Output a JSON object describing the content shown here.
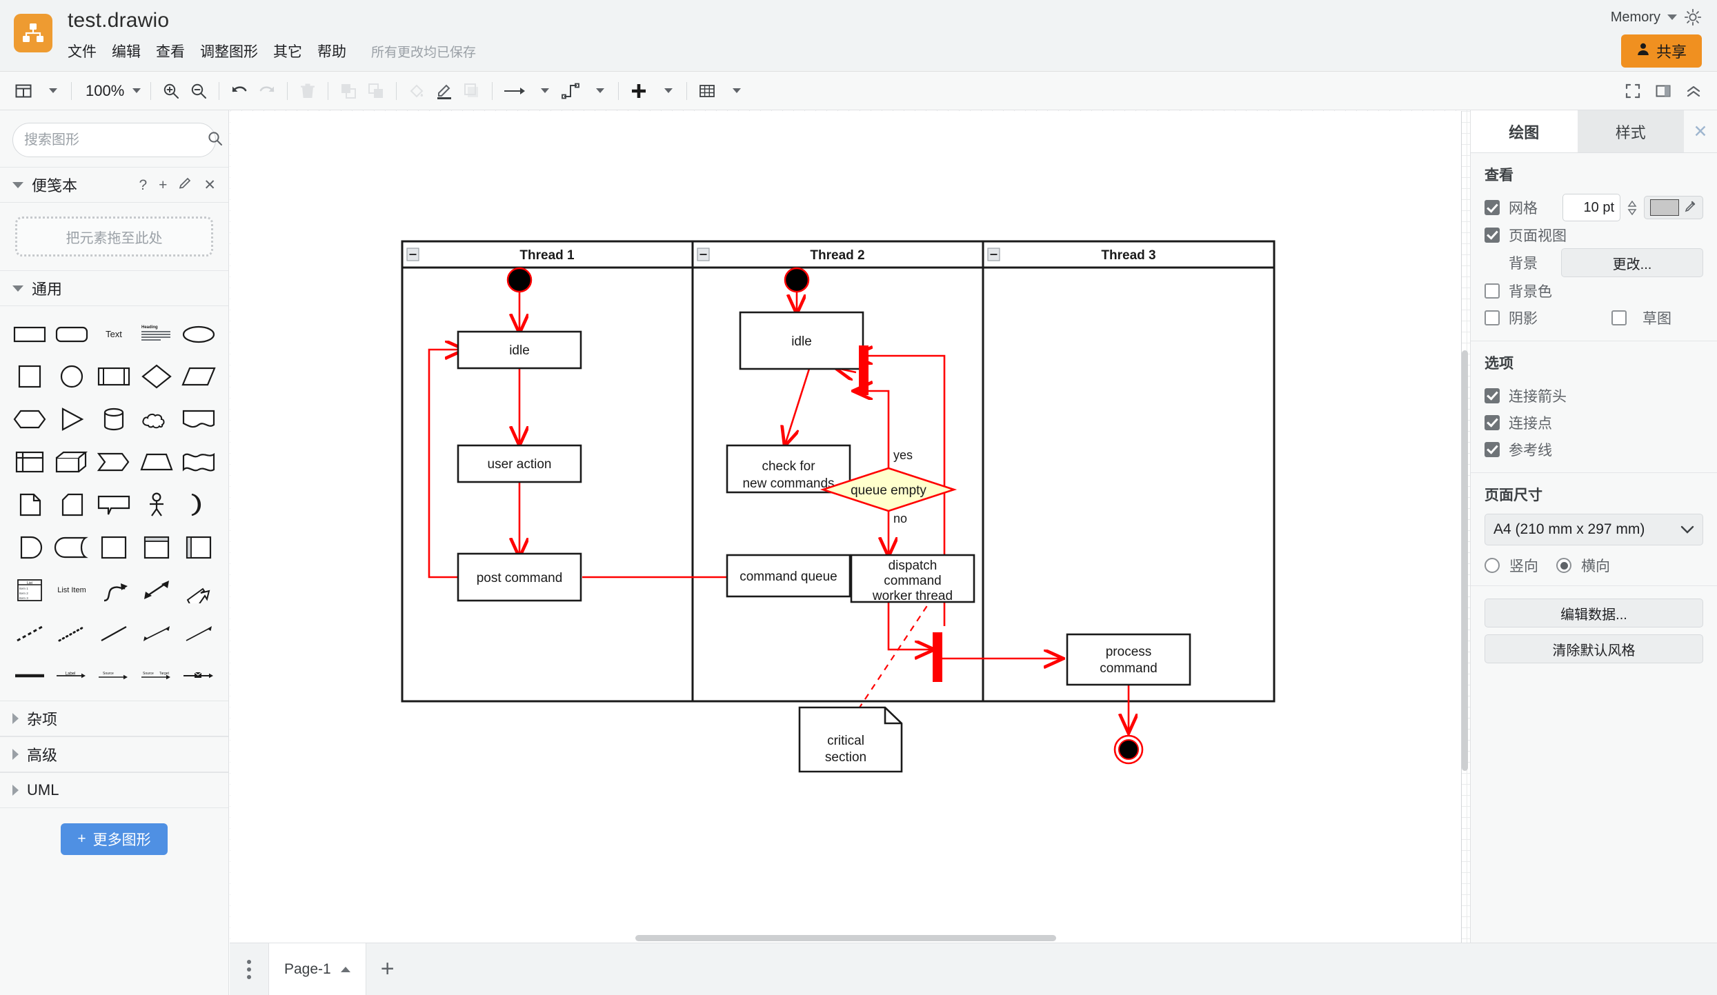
{
  "header": {
    "logo_icon": "drawio-logo-icon",
    "doc_title": "test.drawio",
    "menus": [
      "文件",
      "编辑",
      "查看",
      "调整图形",
      "其它",
      "帮助"
    ],
    "save_status": "所有更改均已保存",
    "memory_label": "Memory",
    "theme_icon": "sun-icon",
    "share_label": "共享",
    "share_icon": "user-icon",
    "share_color": "#f09020"
  },
  "toolbar": {
    "view_layout_icon": "panel-layout-icon",
    "zoom_level": "100%",
    "zoom_in_icon": "zoom-in-icon",
    "zoom_out_icon": "zoom-out-icon",
    "undo_icon": "undo-icon",
    "redo_icon": "redo-icon",
    "delete_icon": "trash-icon",
    "to_front_icon": "bring-to-front-icon",
    "to_back_icon": "send-to-back-icon",
    "fill_icon": "fill-color-icon",
    "line_icon": "line-color-icon",
    "shadow_icon": "shadow-icon",
    "waypoints_icon": "arrow-style-icon",
    "connection_icon": "connection-style-icon",
    "insert_icon": "plus-icon",
    "table_icon": "table-icon",
    "fullscreen_icon": "fullscreen-icon",
    "format_panel_icon": "format-panel-icon",
    "collapse_icon": "chevron-double-up-icon"
  },
  "sidebar": {
    "search_placeholder": "搜索图形",
    "search_value": "",
    "search_icon": "search-icon",
    "scratchpad": {
      "title": "便笺本",
      "help_icon": "question-icon",
      "add_icon": "plus-icon",
      "edit_icon": "pencil-icon",
      "close_icon": "close-icon",
      "dropzone_text": "把元素拖至此处"
    },
    "general_section": {
      "title": "通用",
      "shapes": [
        "rectangle",
        "rounded-rectangle",
        "text",
        "textbox",
        "ellipse",
        "square",
        "circle",
        "process",
        "rhombus",
        "parallelogram",
        "hexagon",
        "triangle",
        "cylinder",
        "cloud",
        "document",
        "internal-storage",
        "cube",
        "step",
        "trapezoid",
        "tape",
        "note",
        "card",
        "callout",
        "actor",
        "or-shape",
        "data-storage",
        "delay",
        "container",
        "vertical-container",
        "horizontal-container",
        "list",
        "list-item",
        "curve-arrow",
        "bidirectional-arrow",
        "block-arrow",
        "dashed-line",
        "dotted-line",
        "plain-line",
        "bidirectional-line",
        "directional-line",
        "thick-line",
        "labeled-arrow",
        "source-target-arrow",
        "source-target-label-arrow",
        "message-arrow"
      ]
    },
    "collapsed_sections": [
      "杂项",
      "高级",
      "UML"
    ],
    "more_shapes_label": "更多图形",
    "more_shapes_icon": "plus-icon",
    "more_shapes_color": "#4f90e3"
  },
  "right_panel": {
    "tabs": [
      {
        "label": "绘图",
        "active": true
      },
      {
        "label": "样式",
        "active": false
      }
    ],
    "close_icon": "close-icon",
    "view_section": {
      "title": "查看",
      "grid_label": "网格",
      "grid_checked": true,
      "grid_size": "10 pt",
      "grid_color": "#c8c8c8",
      "eyedropper_icon": "eyedropper-icon",
      "page_view_label": "页面视图",
      "page_view_checked": true,
      "background_label": "背景",
      "background_button": "更改...",
      "background_color_label": "背景色",
      "background_color_checked": false,
      "shadow_label": "阴影",
      "shadow_checked": false,
      "sketch_label": "草图",
      "sketch_checked": false
    },
    "options_section": {
      "title": "选项",
      "items": [
        {
          "label": "连接箭头",
          "checked": true
        },
        {
          "label": "连接点",
          "checked": true
        },
        {
          "label": "参考线",
          "checked": true
        }
      ]
    },
    "page_size_section": {
      "title": "页面尺寸",
      "selected": "A4 (210 mm x 297 mm)",
      "orientation": [
        {
          "label": "竖向",
          "checked": false
        },
        {
          "label": "横向",
          "checked": true
        }
      ]
    },
    "buttons": [
      "编辑数据...",
      "清除默认风格"
    ]
  },
  "bottom_bar": {
    "menu_icon": "vertical-dots-icon",
    "page_tab": "Page-1",
    "page_tab_chevron": "chevron-up-icon",
    "add_page_icon": "plus-icon"
  },
  "diagram": {
    "type": "uml-activity-swimlane",
    "accent_color": "#ff0000",
    "decision_fill": "#ffffcc",
    "lanes": [
      {
        "title": "Thread 1",
        "collapse_icon": "collapse-icon"
      },
      {
        "title": "Thread 2",
        "collapse_icon": "collapse-icon"
      },
      {
        "title": "Thread 3",
        "collapse_icon": "collapse-icon"
      }
    ],
    "nodes": [
      {
        "id": "start1",
        "type": "initial-node",
        "label": "",
        "lane": "Thread 1"
      },
      {
        "id": "idle1",
        "type": "activity",
        "label": "idle",
        "lane": "Thread 1"
      },
      {
        "id": "useract",
        "type": "activity",
        "label": "user action",
        "lane": "Thread 1"
      },
      {
        "id": "postcmd",
        "type": "activity",
        "label": "post command",
        "lane": "Thread 1"
      },
      {
        "id": "start2",
        "type": "initial-node",
        "label": "",
        "lane": "Thread 2"
      },
      {
        "id": "idle2",
        "type": "activity",
        "label": "idle",
        "lane": "Thread 2"
      },
      {
        "id": "bar1",
        "type": "sync-bar",
        "label": "",
        "lane": "Thread 2"
      },
      {
        "id": "checkcmd",
        "type": "activity",
        "label": "check for\nnew commands",
        "lane": "Thread 2"
      },
      {
        "id": "qempty",
        "type": "decision",
        "label": "queue empty",
        "lane": "Thread 2"
      },
      {
        "id": "cmdqueue",
        "type": "activity",
        "label": "command queue",
        "lane": "Thread 2"
      },
      {
        "id": "dispatch",
        "type": "activity",
        "label": "dispatch\ncommand\nworker thread",
        "lane": "Thread 2"
      },
      {
        "id": "bar2",
        "type": "sync-bar",
        "label": "",
        "lane": "Thread 2"
      },
      {
        "id": "note",
        "type": "note",
        "label": "critical\nsection",
        "lane": "Thread 2"
      },
      {
        "id": "proccmd",
        "type": "activity",
        "label": "process\ncommand",
        "lane": "Thread 3"
      },
      {
        "id": "end3",
        "type": "final-node",
        "label": "",
        "lane": "Thread 3"
      }
    ],
    "edge_labels": [
      {
        "id": "yes",
        "label": "yes"
      },
      {
        "id": "no",
        "label": "no"
      }
    ]
  }
}
